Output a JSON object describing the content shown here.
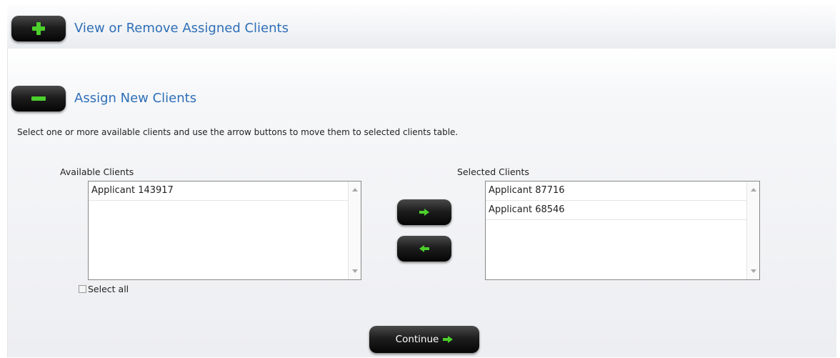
{
  "sections": {
    "view_remove": {
      "title": "View or Remove Assigned Clients",
      "toggle_icon": "plus-icon"
    },
    "assign_new": {
      "title": "Assign New Clients",
      "toggle_icon": "minus-icon"
    }
  },
  "instructions": "Select one or more available clients and use the arrow buttons to move them to selected clients table.",
  "available_clients": {
    "label": "Available Clients",
    "items": [
      "Applicant 143917"
    ]
  },
  "selected_clients": {
    "label": "Selected Clients",
    "items": [
      "Applicant 87716",
      "Applicant 68546"
    ]
  },
  "move_buttons": {
    "add_icon": "arrow-right-icon",
    "remove_icon": "arrow-left-icon"
  },
  "select_all": {
    "label": "Select all",
    "checked": false
  },
  "continue_button": {
    "label": "Continue",
    "icon": "arrow-right-icon"
  },
  "colors": {
    "title_blue": "#2f6fb7",
    "icon_green": "#4ccf2c",
    "button_black": "#111111"
  }
}
